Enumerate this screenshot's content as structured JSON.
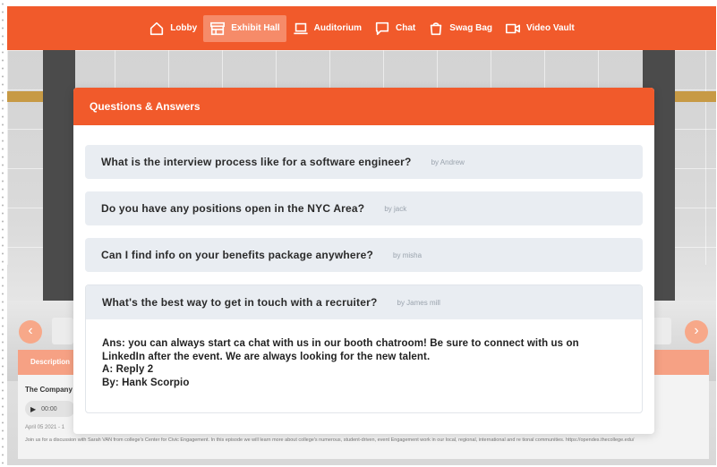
{
  "nav": {
    "items": [
      {
        "label": "Lobby",
        "icon": "home-icon",
        "active": false
      },
      {
        "label": "Exhibit Hall",
        "icon": "booth-icon",
        "active": true
      },
      {
        "label": "Auditorium",
        "icon": "laptop-icon",
        "active": false
      },
      {
        "label": "Chat",
        "icon": "chat-bubble-icon",
        "active": false
      },
      {
        "label": "Swag Bag",
        "icon": "bag-icon",
        "active": false
      },
      {
        "label": "Video Vault",
        "icon": "video-camera-icon",
        "active": false
      }
    ]
  },
  "colors": {
    "accent": "#f15a2b",
    "active_nav": "#f68b69",
    "question_bg": "#e9edf2"
  },
  "modal": {
    "title": "Questions & Answers",
    "questions": [
      {
        "question": "What is the interview process like for a software engineer?",
        "by": "by Andrew"
      },
      {
        "question": "Do you have any positions open in the NYC Area?",
        "by": "by jack"
      },
      {
        "question": "Can I find info on your benefits package anywhere?",
        "by": "by misha"
      },
      {
        "question": "What's the best way to get in touch with a recruiter?",
        "by": "by James mill"
      }
    ],
    "answer": {
      "line1": "Ans: you can always start ca chat with us in our booth chatroom! Be sure to connect with us on",
      "line2": "LinkedIn after the event. We are always looking for the new talent.",
      "line3": "A: Reply 2",
      "line4": "By: Hank Scorpio"
    }
  },
  "background": {
    "carousel_prev": "‹",
    "carousel_next": "›",
    "description_tab": "Description",
    "company": "The Company",
    "player_time": "00:00",
    "date": "April 05 2021 - 1",
    "description_text": "Join us for a discussion with Sarah VAN from college's Center for Civic Engagement. In this episode we will learn more about college's numerous, student-driven, event Engagement work in our local, regional, international and re tional communities. https://opendes.thecollege.edu/"
  }
}
